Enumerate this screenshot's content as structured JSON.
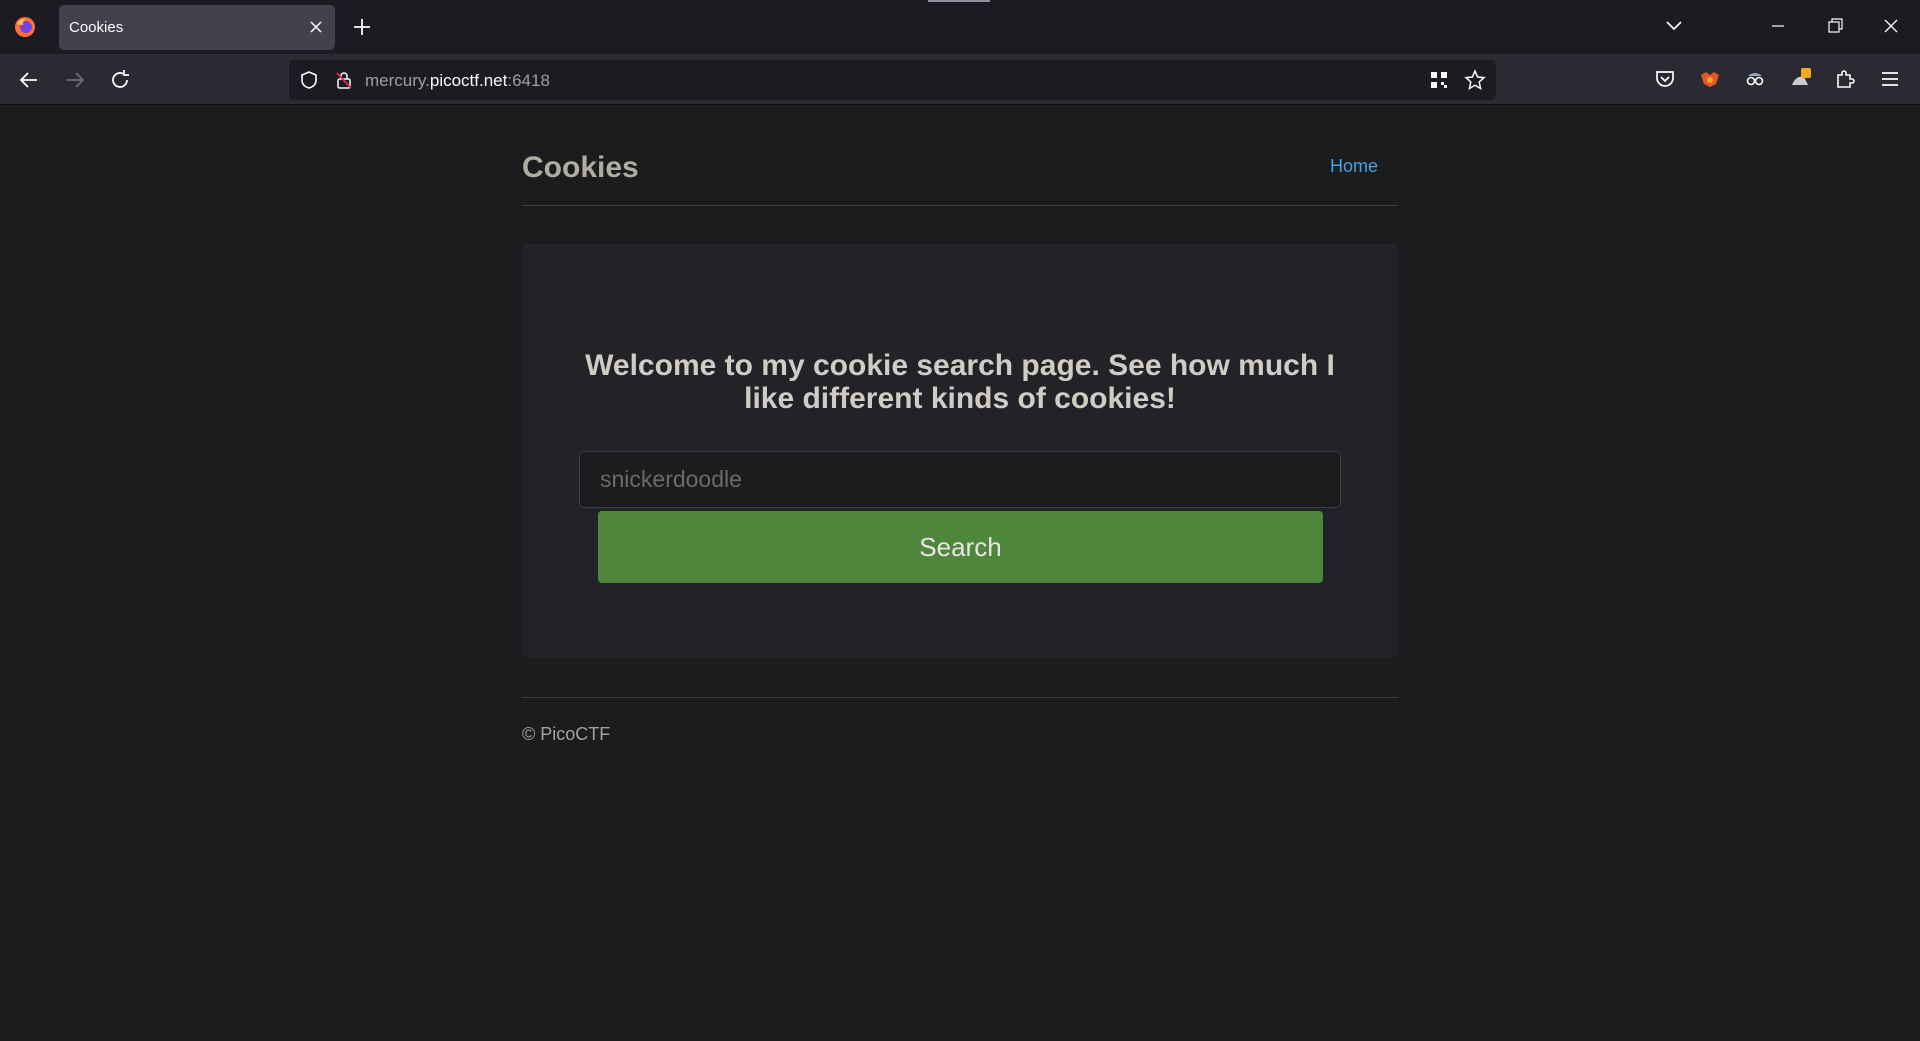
{
  "browser": {
    "tab": {
      "title": "Cookies"
    },
    "url": {
      "prefix": "mercury.",
      "host": "picoctf.net",
      "suffix": ":6418"
    }
  },
  "site": {
    "title": "Cookies",
    "nav": {
      "home_label": "Home"
    },
    "jumbotron": {
      "heading": "Welcome to my cookie search page. See how much I like different kinds of cookies!",
      "search_placeholder": "snickerdoodle",
      "search_value": "",
      "search_button_label": "Search"
    },
    "footer": {
      "text": "© PicoCTF"
    }
  },
  "colors": {
    "accent_button": "#4e873b",
    "link": "#4a9fe0",
    "page_background": "#1b1c1e"
  }
}
